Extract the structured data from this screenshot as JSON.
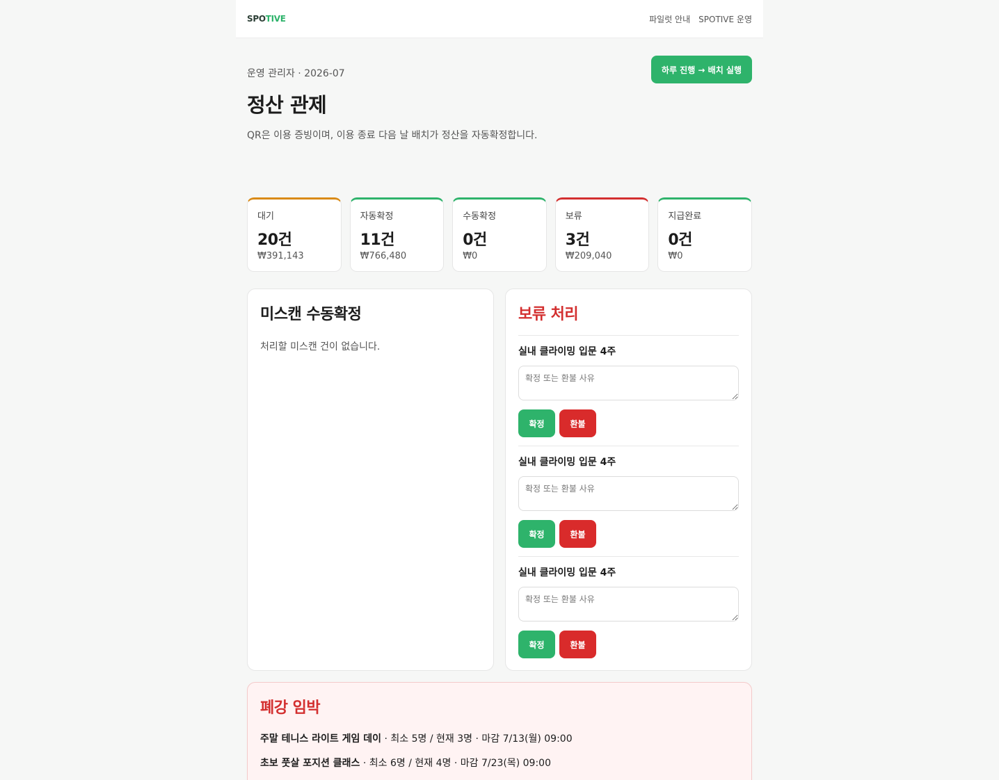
{
  "topbar": {
    "logo_a": "SPO",
    "logo_b": "TIVE",
    "nav": [
      "파일럿 안내",
      "SPOTIVE 운영"
    ]
  },
  "header": {
    "eyebrow": "운영 관리자 · 2026-07",
    "title": "정산 관제",
    "desc": "QR은 이용 증빙이며, 이용 종료 다음 날 배치가 정산을 자동확정합니다.",
    "run_button": "하루 진행 → 배치 실행"
  },
  "stats": [
    {
      "label": "대기",
      "count": "20건",
      "amount": "₩391,143",
      "color": "#d98a16"
    },
    {
      "label": "자동확정",
      "count": "11건",
      "amount": "₩766,480",
      "color": "#2eb36b"
    },
    {
      "label": "수동확정",
      "count": "0건",
      "amount": "₩0",
      "color": "#2eb36b"
    },
    {
      "label": "보류",
      "count": "3건",
      "amount": "₩209,040",
      "color": "#d32f2f"
    },
    {
      "label": "지급완료",
      "count": "0건",
      "amount": "₩0",
      "color": "#2eb36b"
    }
  ],
  "miscan": {
    "title": "미스캔 수동확정",
    "empty": "처리할 미스캔 건이 없습니다."
  },
  "hold": {
    "title": "보류 처리",
    "items": [
      {
        "title": "실내 클라이밍 입문 4주",
        "placeholder": "확정 또는 환불 사유",
        "confirm": "확정",
        "refund": "환불"
      },
      {
        "title": "실내 클라이밍 입문 4주",
        "placeholder": "확정 또는 환불 사유",
        "confirm": "확정",
        "refund": "환불"
      },
      {
        "title": "실내 클라이밍 입문 4주",
        "placeholder": "확정 또는 환불 사유",
        "confirm": "확정",
        "refund": "환불"
      }
    ]
  },
  "closing": {
    "title": "폐강 임박",
    "items": [
      {
        "name": "주말 테니스 라이트 게임 데이",
        "detail": " · 최소 5명 / 현재 3명 · 마감 7/13(월) 09:00"
      },
      {
        "name": "초보 풋살 포지션 클래스",
        "detail": " · 최소 6명 / 현재 4명 · 마감 7/23(목) 09:00"
      }
    ]
  }
}
